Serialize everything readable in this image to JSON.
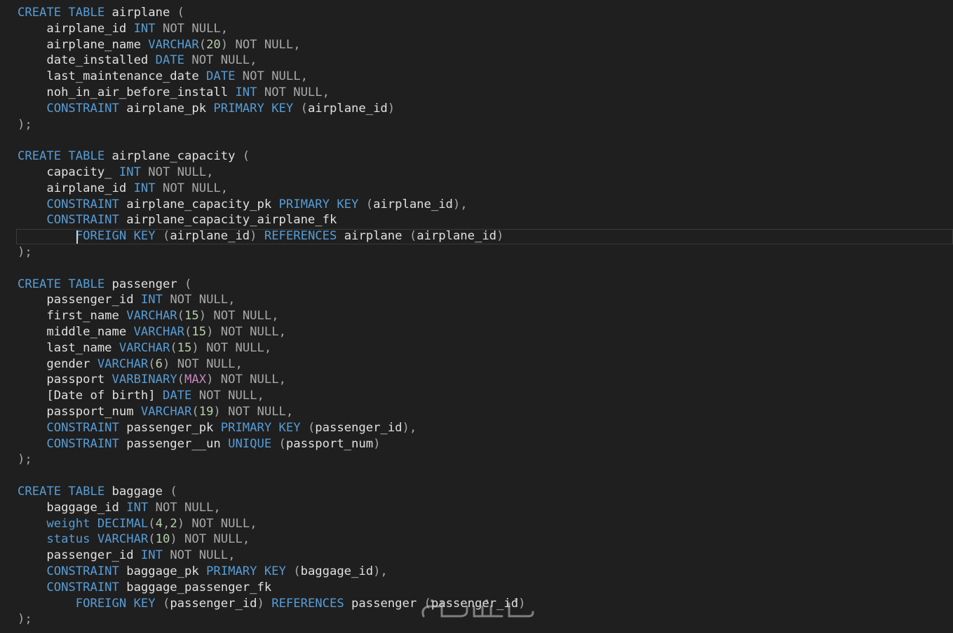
{
  "colors": {
    "background": "#1f1f1f",
    "keyword": "#569cd6",
    "identifier": "#e0e0e0",
    "operator": "#a8a8a8",
    "number": "#b5cea8",
    "function": "#c586c0"
  },
  "editor": {
    "current_line": 15,
    "lines": [
      [
        [
          "kw",
          "CREATE TABLE "
        ],
        [
          "id",
          "airplane "
        ],
        [
          "pn",
          "("
        ]
      ],
      [
        [
          "id",
          "    airplane_id "
        ],
        [
          "kw",
          "INT "
        ],
        [
          "op",
          "NOT NULL,"
        ]
      ],
      [
        [
          "id",
          "    airplane_name "
        ],
        [
          "kw",
          "VARCHAR"
        ],
        [
          "pn",
          "("
        ],
        [
          "num",
          "20"
        ],
        [
          "pn",
          ") "
        ],
        [
          "op",
          "NOT NULL,"
        ]
      ],
      [
        [
          "id",
          "    date_installed "
        ],
        [
          "kw",
          "DATE "
        ],
        [
          "op",
          "NOT NULL,"
        ]
      ],
      [
        [
          "id",
          "    last_maintenance_date "
        ],
        [
          "kw",
          "DATE "
        ],
        [
          "op",
          "NOT NULL,"
        ]
      ],
      [
        [
          "id",
          "    noh_in_air_before_install "
        ],
        [
          "kw",
          "INT "
        ],
        [
          "op",
          "NOT NULL,"
        ]
      ],
      [
        [
          "kw",
          "    CONSTRAINT "
        ],
        [
          "id",
          "airplane_pk "
        ],
        [
          "kw",
          "PRIMARY KEY "
        ],
        [
          "pn",
          "("
        ],
        [
          "id",
          "airplane_id"
        ],
        [
          "pn",
          ")"
        ]
      ],
      [
        [
          "pn",
          ");"
        ]
      ],
      [],
      [
        [
          "kw",
          "CREATE TABLE "
        ],
        [
          "id",
          "airplane_capacity "
        ],
        [
          "pn",
          "("
        ]
      ],
      [
        [
          "id",
          "    capacity_ "
        ],
        [
          "kw",
          "INT "
        ],
        [
          "op",
          "NOT NULL,"
        ]
      ],
      [
        [
          "id",
          "    airplane_id "
        ],
        [
          "kw",
          "INT "
        ],
        [
          "op",
          "NOT NULL,"
        ]
      ],
      [
        [
          "kw",
          "    CONSTRAINT "
        ],
        [
          "id",
          "airplane_capacity_pk "
        ],
        [
          "kw",
          "PRIMARY KEY "
        ],
        [
          "pn",
          "("
        ],
        [
          "id",
          "airplane_id"
        ],
        [
          "pn",
          "),"
        ]
      ],
      [
        [
          "kw",
          "    CONSTRAINT "
        ],
        [
          "id",
          "airplane_capacity_airplane_fk"
        ]
      ],
      [
        [
          "kw",
          "        FOREIGN KEY "
        ],
        [
          "pn",
          "("
        ],
        [
          "id",
          "airplane_id"
        ],
        [
          "pn",
          ") "
        ],
        [
          "kw",
          "REFERENCES "
        ],
        [
          "id",
          "airplane "
        ],
        [
          "pn",
          "("
        ],
        [
          "id",
          "airplane_id"
        ],
        [
          "pn",
          ")"
        ]
      ],
      [
        [
          "pn",
          ");"
        ]
      ],
      [],
      [
        [
          "kw",
          "CREATE TABLE "
        ],
        [
          "id",
          "passenger "
        ],
        [
          "pn",
          "("
        ]
      ],
      [
        [
          "id",
          "    passenger_id "
        ],
        [
          "kw",
          "INT "
        ],
        [
          "op",
          "NOT NULL,"
        ]
      ],
      [
        [
          "id",
          "    first_name "
        ],
        [
          "kw",
          "VARCHAR"
        ],
        [
          "pn",
          "("
        ],
        [
          "num",
          "15"
        ],
        [
          "pn",
          ") "
        ],
        [
          "op",
          "NOT NULL,"
        ]
      ],
      [
        [
          "id",
          "    middle_name "
        ],
        [
          "kw",
          "VARCHAR"
        ],
        [
          "pn",
          "("
        ],
        [
          "num",
          "15"
        ],
        [
          "pn",
          ") "
        ],
        [
          "op",
          "NOT NULL,"
        ]
      ],
      [
        [
          "id",
          "    last_name "
        ],
        [
          "kw",
          "VARCHAR"
        ],
        [
          "pn",
          "("
        ],
        [
          "num",
          "15"
        ],
        [
          "pn",
          ") "
        ],
        [
          "op",
          "NOT NULL,"
        ]
      ],
      [
        [
          "id",
          "    gender "
        ],
        [
          "kw",
          "VARCHAR"
        ],
        [
          "pn",
          "("
        ],
        [
          "num",
          "6"
        ],
        [
          "pn",
          ") "
        ],
        [
          "op",
          "NOT NULL,"
        ]
      ],
      [
        [
          "id",
          "    passport "
        ],
        [
          "kw",
          "VARBINARY"
        ],
        [
          "pn",
          "("
        ],
        [
          "fn",
          "MAX"
        ],
        [
          "pn",
          ") "
        ],
        [
          "op",
          "NOT NULL,"
        ]
      ],
      [
        [
          "id",
          "    [Date of birth] "
        ],
        [
          "kw",
          "DATE "
        ],
        [
          "op",
          "NOT NULL,"
        ]
      ],
      [
        [
          "id",
          "    passport_num "
        ],
        [
          "kw",
          "VARCHAR"
        ],
        [
          "pn",
          "("
        ],
        [
          "num",
          "19"
        ],
        [
          "pn",
          ") "
        ],
        [
          "op",
          "NOT NULL,"
        ]
      ],
      [
        [
          "kw",
          "    CONSTRAINT "
        ],
        [
          "id",
          "passenger_pk "
        ],
        [
          "kw",
          "PRIMARY KEY "
        ],
        [
          "pn",
          "("
        ],
        [
          "id",
          "passenger_id"
        ],
        [
          "pn",
          "),"
        ]
      ],
      [
        [
          "kw",
          "    CONSTRAINT "
        ],
        [
          "id",
          "passenger__un "
        ],
        [
          "kw",
          "UNIQUE "
        ],
        [
          "pn",
          "("
        ],
        [
          "id",
          "passport_num"
        ],
        [
          "pn",
          ")"
        ]
      ],
      [
        [
          "pn",
          ");"
        ]
      ],
      [],
      [
        [
          "kw",
          "CREATE TABLE "
        ],
        [
          "id",
          "baggage "
        ],
        [
          "pn",
          "("
        ]
      ],
      [
        [
          "id",
          "    baggage_id "
        ],
        [
          "kw",
          "INT "
        ],
        [
          "op",
          "NOT NULL,"
        ]
      ],
      [
        [
          "kw",
          "    weight DECIMAL"
        ],
        [
          "pn",
          "("
        ],
        [
          "num",
          "4"
        ],
        [
          "pn",
          ","
        ],
        [
          "num",
          "2"
        ],
        [
          "pn",
          ") "
        ],
        [
          "op",
          "NOT NULL,"
        ]
      ],
      [
        [
          "kw",
          "    status VARCHAR"
        ],
        [
          "pn",
          "("
        ],
        [
          "num",
          "10"
        ],
        [
          "pn",
          ") "
        ],
        [
          "op",
          "NOT NULL,"
        ]
      ],
      [
        [
          "id",
          "    passenger_id "
        ],
        [
          "kw",
          "INT "
        ],
        [
          "op",
          "NOT NULL,"
        ]
      ],
      [
        [
          "kw",
          "    CONSTRAINT "
        ],
        [
          "id",
          "baggage_pk "
        ],
        [
          "kw",
          "PRIMARY KEY "
        ],
        [
          "pn",
          "("
        ],
        [
          "id",
          "baggage_id"
        ],
        [
          "pn",
          "),"
        ]
      ],
      [
        [
          "kw",
          "    CONSTRAINT "
        ],
        [
          "id",
          "baggage_passenger_fk"
        ]
      ],
      [
        [
          "kw",
          "        FOREIGN KEY "
        ],
        [
          "pn",
          "("
        ],
        [
          "id",
          "passenger_id"
        ],
        [
          "pn",
          ") "
        ],
        [
          "kw",
          "REFERENCES "
        ],
        [
          "id",
          "passenger "
        ],
        [
          "pn",
          "("
        ],
        [
          "id",
          "passenger_id"
        ],
        [
          "pn",
          ")"
        ]
      ],
      [
        [
          "pn",
          ");"
        ]
      ]
    ]
  }
}
